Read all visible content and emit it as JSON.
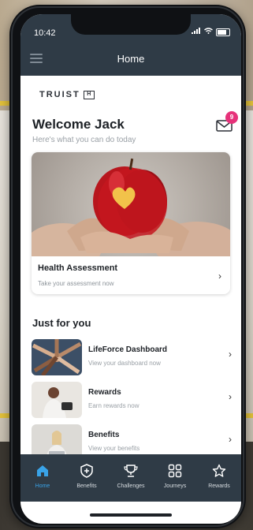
{
  "status": {
    "time": "10:42"
  },
  "header": {
    "title": "Home"
  },
  "brand": {
    "name": "TRUIST",
    "mark": "H"
  },
  "welcome": {
    "title": "Welcome Jack",
    "subtitle": "Here's what you can do today"
  },
  "inbox": {
    "badge_count": "9",
    "icon": "mail-icon"
  },
  "hero_card": {
    "title": "Health Assessment",
    "subtitle": "Take your assessment now"
  },
  "section": {
    "title": "Just for you"
  },
  "items": [
    {
      "title": "LifeForce Dashboard",
      "subtitle": "View your dashboard now"
    },
    {
      "title": "Rewards",
      "subtitle": "Earn rewards now"
    },
    {
      "title": "Benefits",
      "subtitle": "View your benefits"
    }
  ],
  "tabs": [
    {
      "label": "Home",
      "icon": "home-icon",
      "active": true
    },
    {
      "label": "Benefits",
      "icon": "shield-plus-icon"
    },
    {
      "label": "Challenges",
      "icon": "trophy-icon"
    },
    {
      "label": "Journeys",
      "icon": "grid-icon"
    },
    {
      "label": "Rewards",
      "icon": "star-icon"
    }
  ],
  "colors": {
    "header": "#2f3b46",
    "accent": "#39a3e8",
    "badge": "#e6327a"
  }
}
